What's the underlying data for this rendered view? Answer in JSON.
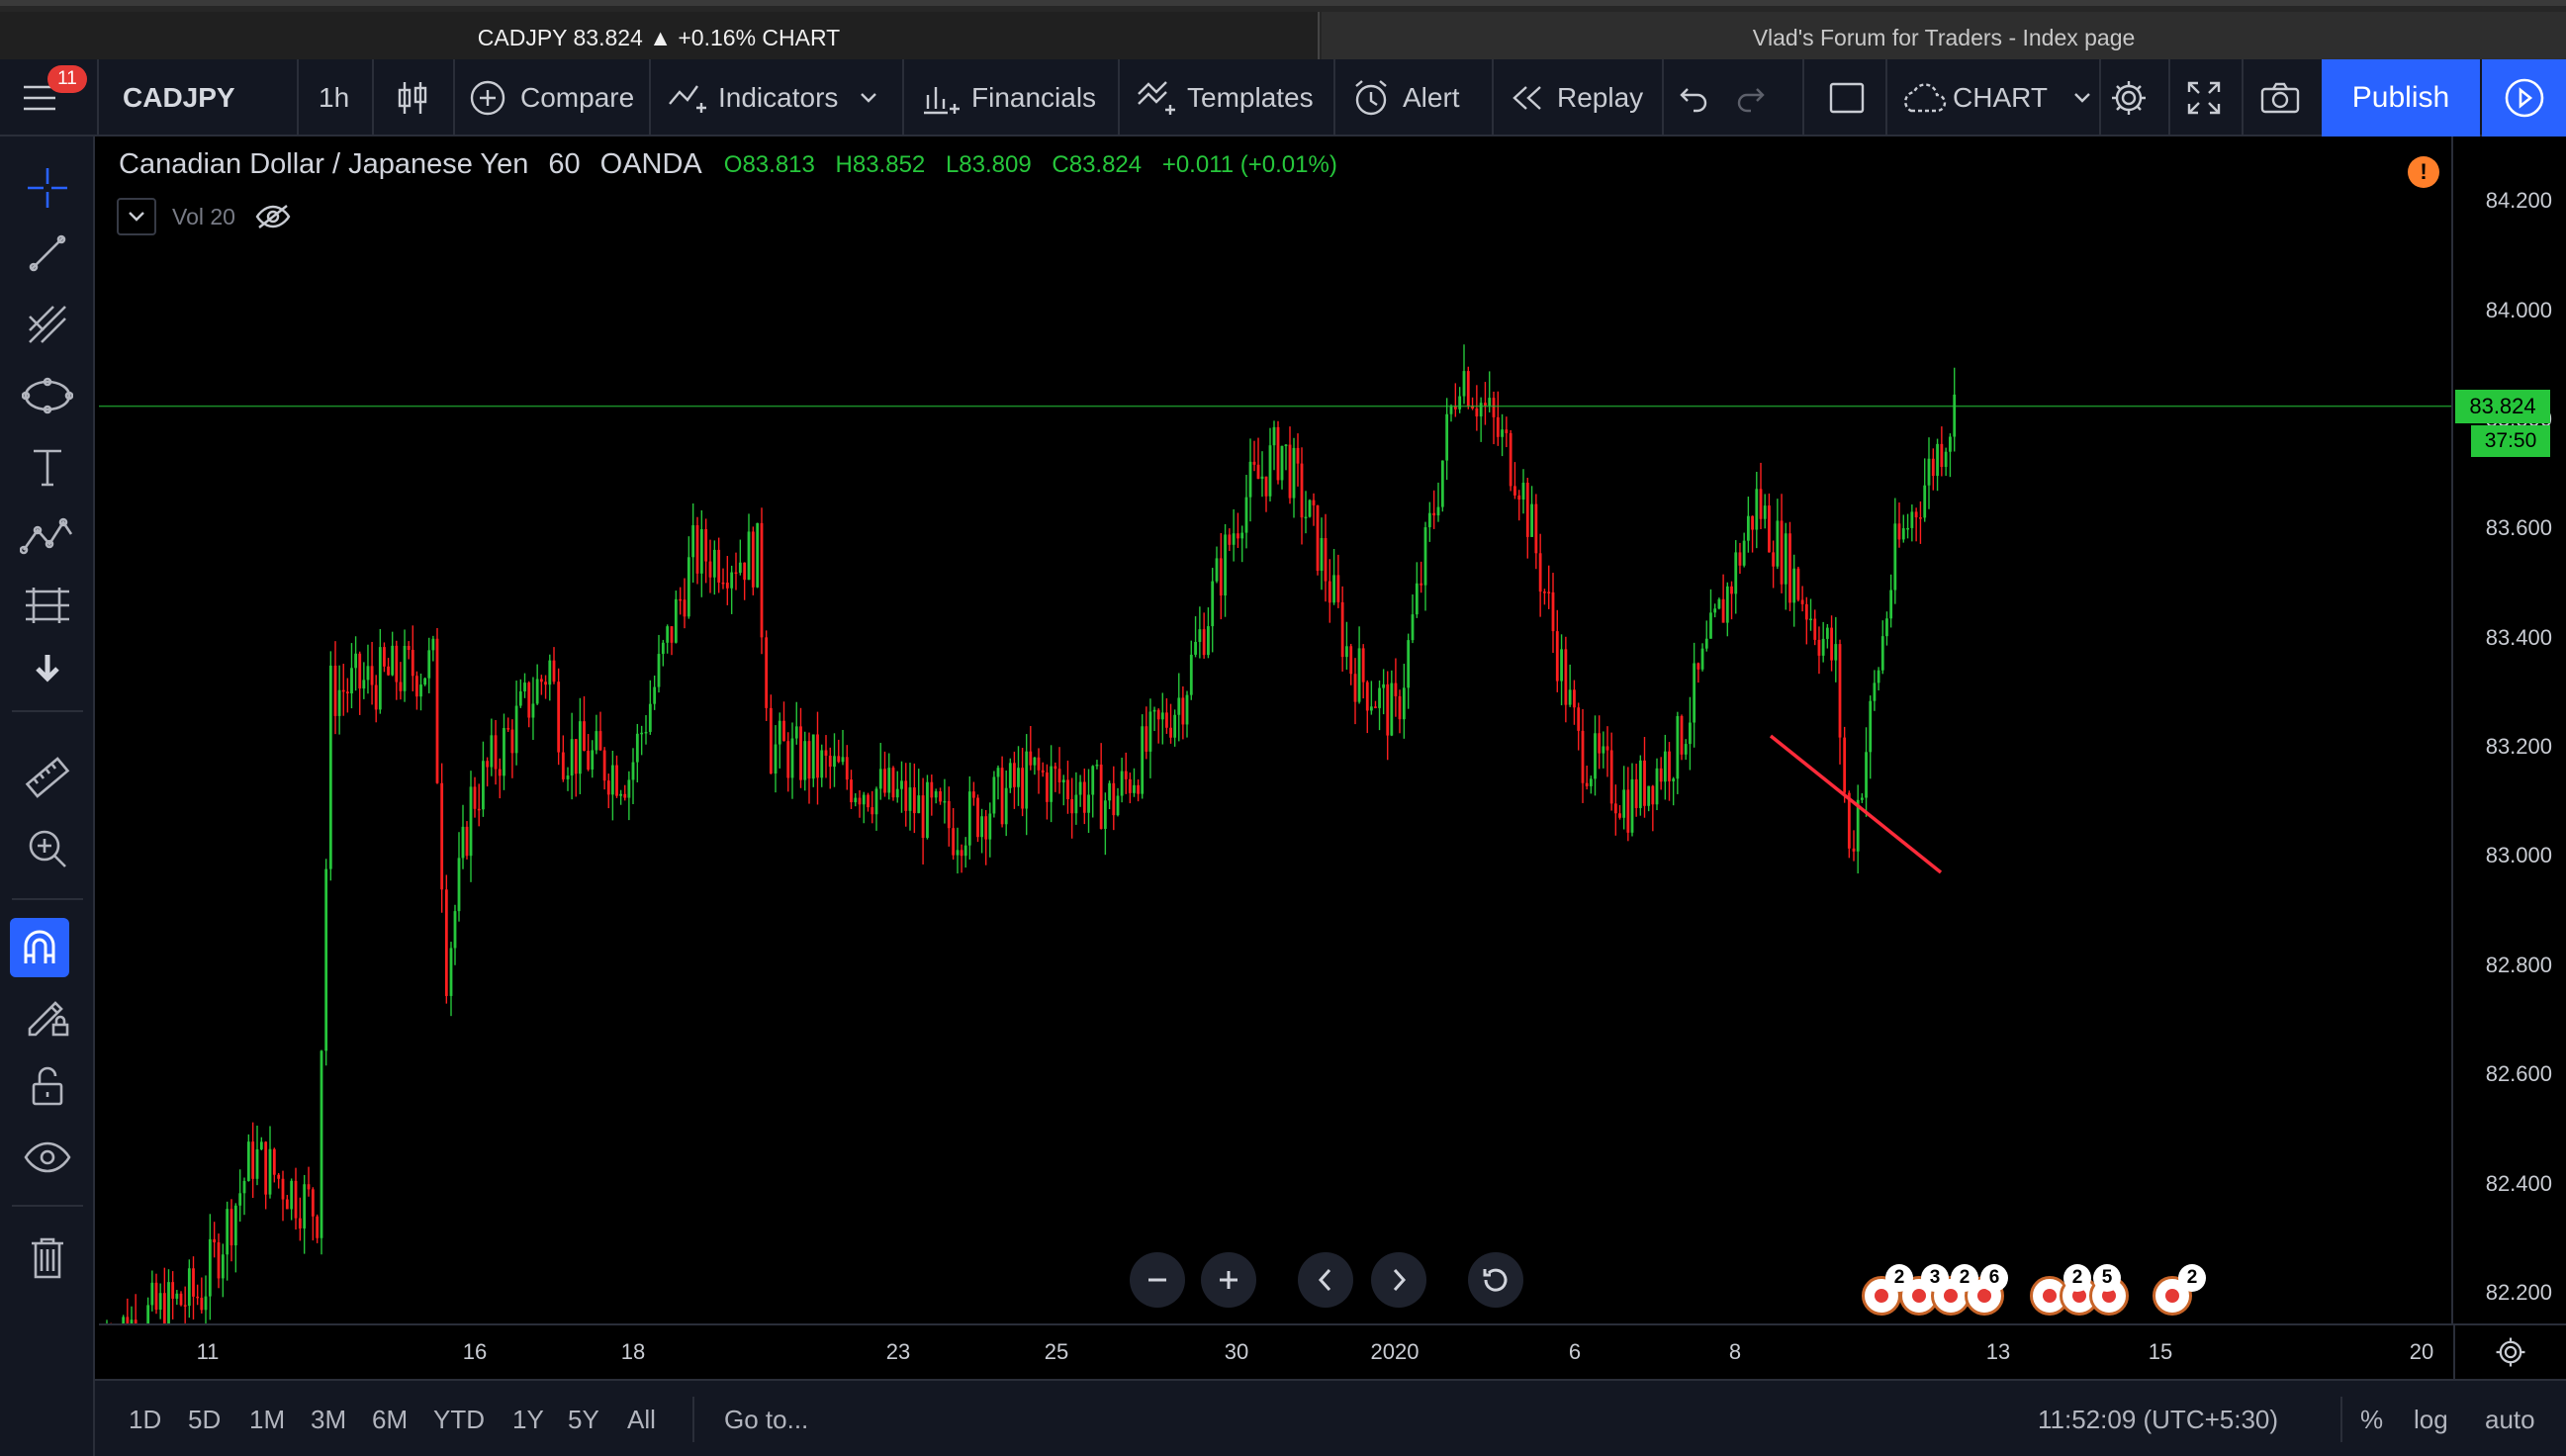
{
  "browser_tabs": [
    {
      "label": "CADJPY 83.824 ▲ +0.16% CHART"
    },
    {
      "label": "Vlad's Forum for Traders - Index page"
    }
  ],
  "toolbar": {
    "notifications": "11",
    "symbol": "CADJPY",
    "interval": "1h",
    "compare": "Compare",
    "indicators": "Indicators",
    "financials": "Financials",
    "templates": "Templates",
    "alert": "Alert",
    "replay": "Replay",
    "layout": "CHART",
    "publish": "Publish"
  },
  "legend": {
    "title": "Canadian Dollar / Japanese Yen",
    "interval": "60",
    "source": "OANDA",
    "open": "O83.813",
    "high": "H83.852",
    "low": "L83.809",
    "close": "C83.824",
    "change": "+0.011 (+0.01%)",
    "volume_label": "Vol 20"
  },
  "price_scale": {
    "labels": [
      "84.200",
      "84.000",
      "83.800",
      "83.600",
      "83.400",
      "83.200",
      "83.000",
      "82.800",
      "82.600",
      "82.400",
      "82.200"
    ],
    "current_price": "83.824",
    "countdown": "37:50"
  },
  "time_scale": {
    "labels": [
      "11",
      "16",
      "18",
      "23",
      "25",
      "30",
      "2020",
      "6",
      "8",
      "13",
      "15",
      "20"
    ]
  },
  "events": {
    "counts": [
      "2",
      "3",
      "2",
      "6",
      "2",
      "5",
      "2"
    ]
  },
  "bottom_bar": {
    "ranges": [
      "1D",
      "5D",
      "1M",
      "3M",
      "6M",
      "YTD",
      "1Y",
      "5Y",
      "All"
    ],
    "goto": "Go to...",
    "clock": "11:52:09 (UTC+5:30)",
    "percent": "%",
    "log": "log",
    "auto": "auto"
  },
  "colors": {
    "up": "#26c63b",
    "down": "#ff1f1f",
    "trendline": "#ff2b3a",
    "accent": "#2962ff",
    "background": "#000000"
  },
  "chart_data": {
    "type": "candlestick",
    "title": "Canadian Dollar / Japanese Yen",
    "ylim": [
      82.1,
      84.2
    ],
    "grid": false,
    "legend_position": "top-left",
    "current_price": 83.824,
    "close_path": [
      {
        "x": "Dec 10",
        "close": 82.12
      },
      {
        "x": "Dec 11",
        "close": 82.2
      },
      {
        "x": "Dec 12",
        "close": 82.45
      },
      {
        "x": "Dec 13",
        "close": 82.35
      },
      {
        "x": "Dec 13",
        "close": 83.3
      },
      {
        "x": "Dec 15",
        "close": 83.35
      },
      {
        "x": "Dec 15",
        "close": 82.8
      },
      {
        "x": "Dec 16",
        "close": 83.1
      },
      {
        "x": "Dec 17",
        "close": 83.35
      },
      {
        "x": "Dec 17",
        "close": 83.2
      },
      {
        "x": "Dec 18",
        "close": 83.15
      },
      {
        "x": "Dec 19",
        "close": 83.55
      },
      {
        "x": "Dec 20",
        "close": 83.55
      },
      {
        "x": "Dec 20",
        "close": 83.2
      },
      {
        "x": "Dec 22",
        "close": 83.1
      },
      {
        "x": "Dec 23",
        "close": 83.05
      },
      {
        "x": "Dec 24",
        "close": 83.15
      },
      {
        "x": "Dec 25",
        "close": 83.1
      },
      {
        "x": "Dec 26",
        "close": 83.3
      },
      {
        "x": "Dec 27",
        "close": 83.65
      },
      {
        "x": "Dec 28",
        "close": 83.75
      },
      {
        "x": "Dec 29",
        "close": 83.55
      },
      {
        "x": "Dec 30",
        "close": 83.35
      },
      {
        "x": "Dec 31",
        "close": 83.25
      },
      {
        "x": "Jan 01",
        "close": 83.9
      },
      {
        "x": "Jan 02",
        "close": 83.7
      },
      {
        "x": "Jan 03",
        "close": 83.2
      },
      {
        "x": "Jan 05",
        "close": 83.1
      },
      {
        "x": "Jan 06",
        "close": 83.2
      },
      {
        "x": "Jan 07",
        "close": 83.65
      },
      {
        "x": "Jan 08",
        "close": 83.35
      },
      {
        "x": "Jan 08",
        "close": 83.0
      },
      {
        "x": "Jan 09",
        "close": 83.55
      },
      {
        "x": "Jan 10",
        "close": 83.82
      }
    ],
    "trendline": [
      {
        "x": "Dec 31",
        "y": 83.22
      },
      {
        "x": "Jan 06",
        "y": 82.97
      }
    ],
    "horizontal_line": 83.824
  }
}
